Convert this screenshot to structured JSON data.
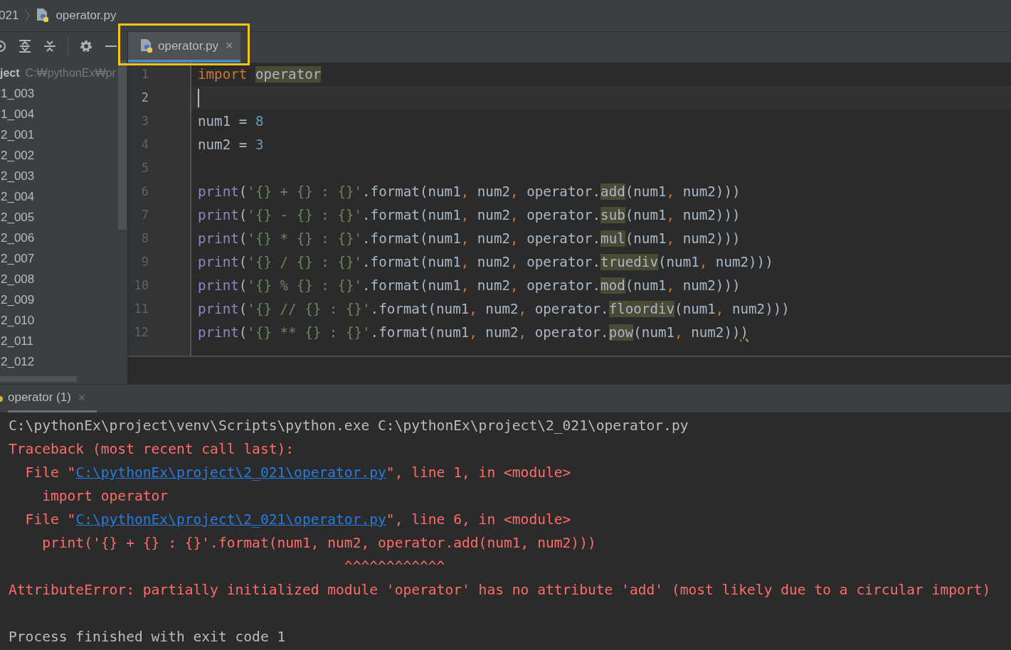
{
  "breadcrumb": {
    "folder": "021",
    "file": "operator.py"
  },
  "project_panel": {
    "title": "ject",
    "path": "C:₩pythonEx₩pr",
    "items": [
      {
        "label": "1_003"
      },
      {
        "label": "1_004"
      },
      {
        "label": "2_001"
      },
      {
        "label": "2_002"
      },
      {
        "label": "2_003"
      },
      {
        "label": "2_004"
      },
      {
        "label": "2_005"
      },
      {
        "label": "2_006"
      },
      {
        "label": "2_007"
      },
      {
        "label": "2_008"
      },
      {
        "label": "2_009"
      },
      {
        "label": "2_010"
      },
      {
        "label": "2_011"
      },
      {
        "label": "2_012"
      }
    ]
  },
  "editor_tabs": [
    {
      "label": "operator.py",
      "close": "×",
      "selected": true
    }
  ],
  "code_lines": [
    {
      "number": "1",
      "current": false,
      "tokens": [
        {
          "kind": "keyword",
          "text": "import "
        },
        {
          "kind": "highlight",
          "text": "operator"
        }
      ]
    },
    {
      "number": "2",
      "current": true
    },
    {
      "number": "3",
      "current": false,
      "tokens": [
        {
          "kind": "plain",
          "text": "num1 = "
        },
        {
          "kind": "number",
          "text": "8"
        }
      ]
    },
    {
      "number": "4",
      "current": false,
      "tokens": [
        {
          "kind": "plain",
          "text": "num2 = "
        },
        {
          "kind": "number",
          "text": "3"
        }
      ]
    },
    {
      "number": "5",
      "current": false
    },
    {
      "number": "6",
      "current": false,
      "tokens": [
        {
          "kind": "builtin",
          "text": "print"
        },
        {
          "kind": "plain",
          "text": "("
        },
        {
          "kind": "string",
          "text": "'{} + {} : {}'"
        },
        {
          "kind": "plain",
          "text": ".format(num1"
        },
        {
          "kind": "comma",
          "text": ","
        },
        {
          "kind": "plain",
          "text": " num2"
        },
        {
          "kind": "comma",
          "text": ","
        },
        {
          "kind": "plain",
          "text": " operator."
        },
        {
          "kind": "highlight",
          "text": "add"
        },
        {
          "kind": "plain",
          "text": "(num1"
        },
        {
          "kind": "comma",
          "text": ","
        },
        {
          "kind": "plain",
          "text": " num2)))"
        }
      ]
    },
    {
      "number": "7",
      "current": false,
      "tokens": [
        {
          "kind": "builtin",
          "text": "print"
        },
        {
          "kind": "plain",
          "text": "("
        },
        {
          "kind": "string",
          "text": "'{} - {} : {}'"
        },
        {
          "kind": "plain",
          "text": ".format(num1"
        },
        {
          "kind": "comma",
          "text": ","
        },
        {
          "kind": "plain",
          "text": " num2"
        },
        {
          "kind": "comma",
          "text": ","
        },
        {
          "kind": "plain",
          "text": " operator."
        },
        {
          "kind": "highlight",
          "text": "sub"
        },
        {
          "kind": "plain",
          "text": "(num1"
        },
        {
          "kind": "comma",
          "text": ","
        },
        {
          "kind": "plain",
          "text": " num2)))"
        }
      ]
    },
    {
      "number": "8",
      "current": false,
      "tokens": [
        {
          "kind": "builtin",
          "text": "print"
        },
        {
          "kind": "plain",
          "text": "("
        },
        {
          "kind": "string",
          "text": "'{} * {} : {}'"
        },
        {
          "kind": "plain",
          "text": ".format(num1"
        },
        {
          "kind": "comma",
          "text": ","
        },
        {
          "kind": "plain",
          "text": " num2"
        },
        {
          "kind": "comma",
          "text": ","
        },
        {
          "kind": "plain",
          "text": " operator."
        },
        {
          "kind": "highlight",
          "text": "mul"
        },
        {
          "kind": "plain",
          "text": "(num1"
        },
        {
          "kind": "comma",
          "text": ","
        },
        {
          "kind": "plain",
          "text": " num2)))"
        }
      ]
    },
    {
      "number": "9",
      "current": false,
      "tokens": [
        {
          "kind": "builtin",
          "text": "print"
        },
        {
          "kind": "plain",
          "text": "("
        },
        {
          "kind": "string",
          "text": "'{} / {} : {}'"
        },
        {
          "kind": "plain",
          "text": ".format(num1"
        },
        {
          "kind": "comma",
          "text": ","
        },
        {
          "kind": "plain",
          "text": " num2"
        },
        {
          "kind": "comma",
          "text": ","
        },
        {
          "kind": "plain",
          "text": " operator."
        },
        {
          "kind": "highlight",
          "text": "truediv"
        },
        {
          "kind": "plain",
          "text": "(num1"
        },
        {
          "kind": "comma",
          "text": ","
        },
        {
          "kind": "plain",
          "text": " num2)))"
        }
      ]
    },
    {
      "number": "10",
      "current": false,
      "tokens": [
        {
          "kind": "builtin",
          "text": "print"
        },
        {
          "kind": "plain",
          "text": "("
        },
        {
          "kind": "string",
          "text": "'{} % {} : {}'"
        },
        {
          "kind": "plain",
          "text": ".format(num1"
        },
        {
          "kind": "comma",
          "text": ","
        },
        {
          "kind": "plain",
          "text": " num2"
        },
        {
          "kind": "comma",
          "text": ","
        },
        {
          "kind": "plain",
          "text": " operator."
        },
        {
          "kind": "highlight",
          "text": "mod"
        },
        {
          "kind": "plain",
          "text": "(num1"
        },
        {
          "kind": "comma",
          "text": ","
        },
        {
          "kind": "plain",
          "text": " num2)))"
        }
      ]
    },
    {
      "number": "11",
      "current": false,
      "tokens": [
        {
          "kind": "builtin",
          "text": "print"
        },
        {
          "kind": "plain",
          "text": "("
        },
        {
          "kind": "string",
          "text": "'{} // {} : {}'"
        },
        {
          "kind": "plain",
          "text": ".format(num1"
        },
        {
          "kind": "comma",
          "text": ","
        },
        {
          "kind": "plain",
          "text": " num2"
        },
        {
          "kind": "comma",
          "text": ","
        },
        {
          "kind": "plain",
          "text": " operator."
        },
        {
          "kind": "highlight",
          "text": "floordiv"
        },
        {
          "kind": "plain",
          "text": "(num1"
        },
        {
          "kind": "comma",
          "text": ","
        },
        {
          "kind": "plain",
          "text": " num2)))"
        }
      ]
    },
    {
      "number": "12",
      "current": false,
      "tokens": [
        {
          "kind": "builtin",
          "text": "print"
        },
        {
          "kind": "plain",
          "text": "("
        },
        {
          "kind": "string",
          "text": "'{} ** {} : {}'"
        },
        {
          "kind": "plain",
          "text": ".format(num1"
        },
        {
          "kind": "comma",
          "text": ","
        },
        {
          "kind": "plain",
          "text": " num2"
        },
        {
          "kind": "comma",
          "text": ","
        },
        {
          "kind": "plain",
          "text": " operator."
        },
        {
          "kind": "highlight",
          "text": "pow"
        },
        {
          "kind": "plain",
          "text": "(num1"
        },
        {
          "kind": "comma",
          "text": ","
        },
        {
          "kind": "plain",
          "text": " num2))"
        },
        {
          "kind": "warning",
          "text": ")"
        }
      ]
    }
  ],
  "run_tabs": [
    {
      "label": "operator (1)",
      "close": "×",
      "selected": true
    }
  ],
  "console_lines": [
    {
      "kind": "output",
      "segments": [
        {
          "kind": "text",
          "text": "C:\\pythonEx\\project\\venv\\Scripts\\python.exe C:\\pythonEx\\project\\2_021\\operator.py"
        }
      ]
    },
    {
      "kind": "error",
      "segments": [
        {
          "kind": "text",
          "text": "Traceback (most recent call last):"
        }
      ]
    },
    {
      "kind": "error",
      "segments": [
        {
          "kind": "text",
          "text": "  File \""
        },
        {
          "kind": "link",
          "text": "C:\\pythonEx\\project\\2_021\\operator.py"
        },
        {
          "kind": "text",
          "text": "\", line 1, in <module>"
        }
      ]
    },
    {
      "kind": "error",
      "segments": [
        {
          "kind": "text",
          "text": "    import operator"
        }
      ]
    },
    {
      "kind": "error",
      "segments": [
        {
          "kind": "text",
          "text": "  File \""
        },
        {
          "kind": "link",
          "text": "C:\\pythonEx\\project\\2_021\\operator.py"
        },
        {
          "kind": "text",
          "text": "\", line 6, in <module>"
        }
      ]
    },
    {
      "kind": "error",
      "segments": [
        {
          "kind": "text",
          "text": "    print('{} + {} : {}'.format(num1, num2, operator.add(num1, num2)))"
        }
      ]
    },
    {
      "kind": "error",
      "segments": [
        {
          "kind": "text",
          "text": "                                        ^^^^^^^^^^^^"
        }
      ]
    },
    {
      "kind": "error",
      "segments": [
        {
          "kind": "text",
          "text": "AttributeError: partially initialized module 'operator' has no attribute 'add' (most likely due to a circular import)"
        }
      ]
    },
    {
      "kind": "blank"
    },
    {
      "kind": "output",
      "segments": [
        {
          "kind": "text",
          "text": "Process finished with exit code 1"
        }
      ]
    }
  ]
}
